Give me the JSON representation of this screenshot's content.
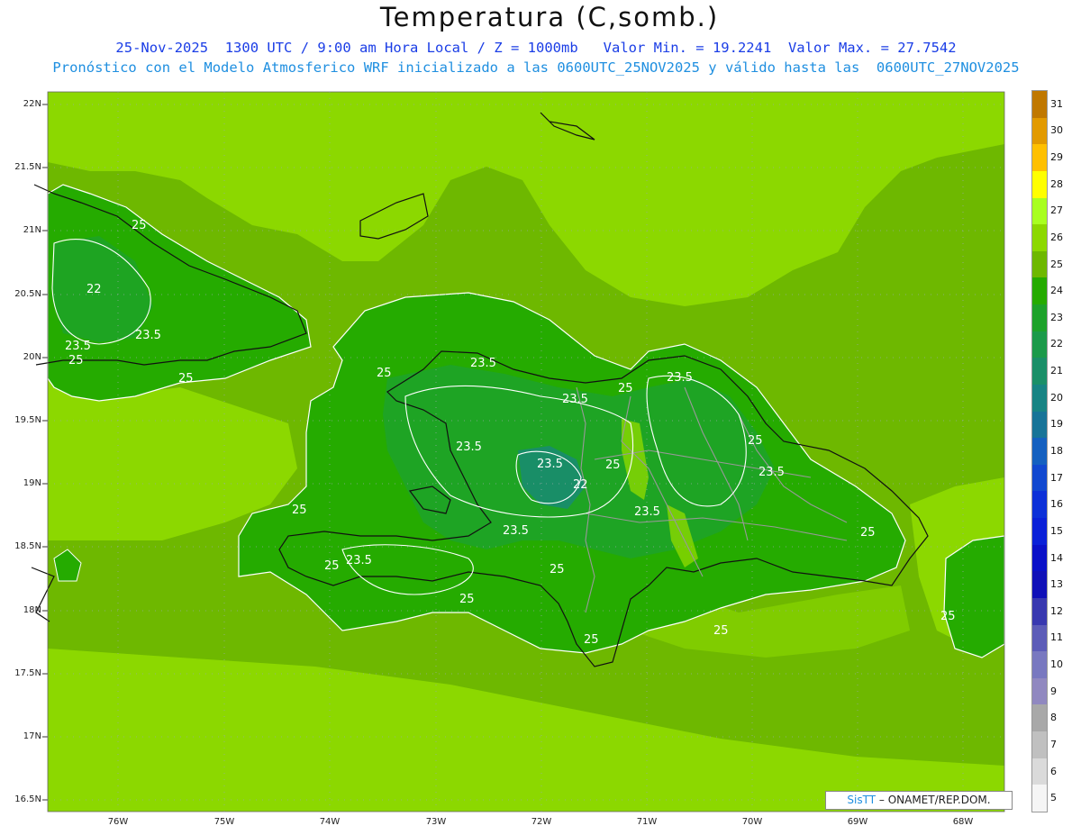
{
  "header": {
    "title": "Temperatura (C,somb.)",
    "line1": "25-Nov-2025  1300 UTC / 9:00 am Hora Local / Z = 1000mb   Valor Min. = 19.2241  Valor Max. = 27.7542",
    "line2": "Pronóstico con el Modelo Atmosferico WRF inicializado a las 0600UTC_25NOV2025 y válido hasta las  0600UTC_27NOV2025"
  },
  "axes": {
    "lat_labels": [
      "22N",
      "21.5N",
      "21N",
      "20.5N",
      "20N",
      "19.5N",
      "19N",
      "18.5N",
      "18N",
      "17.5N",
      "17N",
      "16.5N"
    ],
    "lon_labels": [
      "76W",
      "75W",
      "74W",
      "73W",
      "72W",
      "71W",
      "70W",
      "69W",
      "68W"
    ]
  },
  "credit": {
    "brand": "SisTT",
    "rest": "– ONAMET/REP.DOM."
  },
  "colorbar": {
    "levels": [
      "31",
      "30",
      "29",
      "28",
      "27",
      "26",
      "25",
      "24",
      "23",
      "22",
      "21",
      "20",
      "19",
      "18",
      "17",
      "16",
      "15",
      "14",
      "13",
      "12",
      "11",
      "10",
      "9",
      "8",
      "7",
      "6",
      "5"
    ],
    "colors": [
      "#c07800",
      "#e29a00",
      "#ffc000",
      "#ffff00",
      "#a8ff20",
      "#8cd800",
      "#6eb800",
      "#25ab00",
      "#1da22a",
      "#1b9a4a",
      "#1a8f68",
      "#178484",
      "#177498",
      "#1460c0",
      "#1148d0",
      "#0c30d8",
      "#0a20d8",
      "#0a10c8",
      "#1010b8",
      "#3838b0",
      "#5c5cb8",
      "#7878c0",
      "#9088c0",
      "#a8a8a8",
      "#c0c0c0",
      "#dadada",
      "#f5f5f5"
    ]
  },
  "contour_labels": [
    "25",
    "22",
    "23.5",
    "23.5",
    "25",
    "25",
    "23.5",
    "23.5",
    "25",
    "23.5",
    "23.5",
    "25",
    "23.5",
    "22",
    "25",
    "23.5",
    "23.5",
    "25",
    "25",
    "25",
    "23.5",
    "23.5",
    "25",
    "25",
    "25",
    "25",
    "25",
    "25"
  ]
}
